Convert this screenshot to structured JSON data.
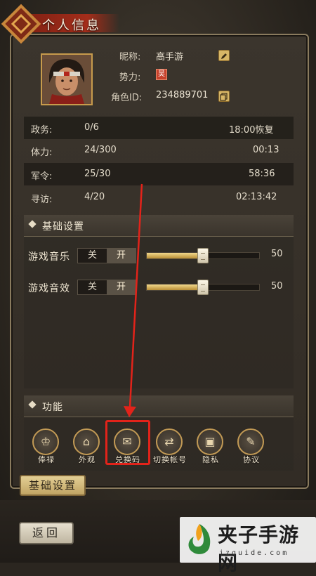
{
  "header": {
    "title": "个人信息"
  },
  "profile": {
    "nickname_label": "昵称:",
    "nickname_value": "高手游",
    "faction_label": "势力:",
    "faction_badge": "吴",
    "role_id_label": "角色ID:",
    "role_id_value": "234889701"
  },
  "stats": [
    {
      "label": "政务:",
      "value": "0/6",
      "extra": "18:00恢复"
    },
    {
      "label": "体力:",
      "value": "24/300",
      "extra": "00:13"
    },
    {
      "label": "军令:",
      "value": "25/30",
      "extra": "58:36"
    },
    {
      "label": "寻访:",
      "value": "4/20",
      "extra": "02:13:42"
    }
  ],
  "settings": {
    "title": "基础设置",
    "music": {
      "label": "游戏音乐",
      "off": "关",
      "on": "开",
      "value": 50,
      "level": 0.5
    },
    "sfx": {
      "label": "游戏音效",
      "off": "关",
      "on": "开",
      "value": 50,
      "level": 0.5
    }
  },
  "functions": {
    "title": "功能",
    "items": [
      {
        "label": "俸禄",
        "icon": "salary-icon"
      },
      {
        "label": "外观",
        "icon": "appearance-icon"
      },
      {
        "label": "兑换码",
        "icon": "redeem-code-icon"
      },
      {
        "label": "切换帐号",
        "icon": "switch-account-icon"
      },
      {
        "label": "隐私",
        "icon": "privacy-icon"
      },
      {
        "label": "协议",
        "icon": "agreement-icon"
      }
    ]
  },
  "tabs": {
    "basic_settings": "基础设置"
  },
  "footer": {
    "back": "返回"
  },
  "watermark": {
    "title": "夹子手游网",
    "subtitle": "jzguide.com"
  },
  "colors": {
    "accent_gold": "#c29a55",
    "highlight_red": "#e2231a",
    "title_red": "#a42d1a"
  }
}
